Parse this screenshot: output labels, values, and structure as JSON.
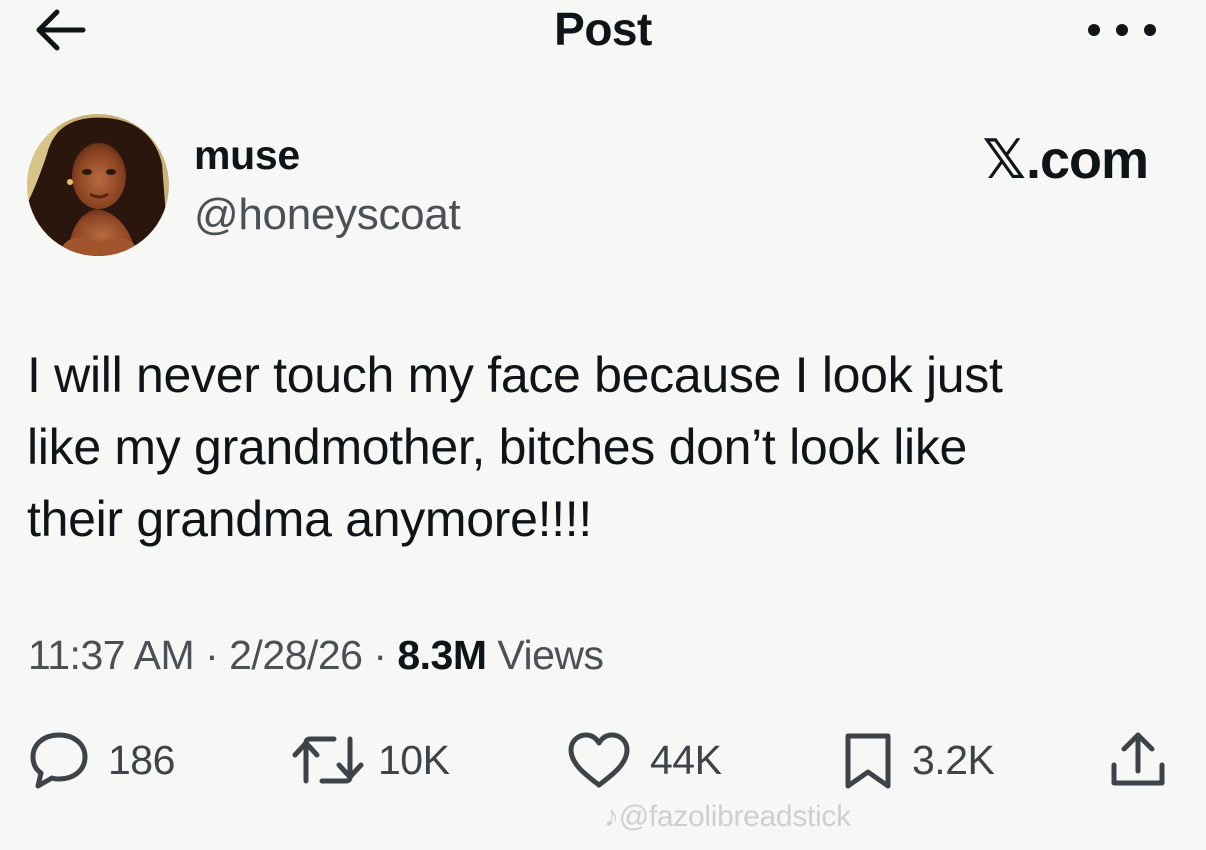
{
  "header": {
    "title": "Post",
    "back_icon": "arrow-left-icon",
    "more_icon": "more-horizontal-icon"
  },
  "author": {
    "display_name": "muse",
    "handle": "@honeyscoat",
    "avatar_icon": "profile-photo"
  },
  "brand": {
    "x_glyph": "𝕏",
    "domain": ".com"
  },
  "tweet": {
    "text": "I will never touch my face because I look just\nlike my grandmother, bitches don’t look like\ntheir grandma anymore!!!!"
  },
  "meta": {
    "time": "11:37 AM",
    "sep1": " · ",
    "date": "2/28/26",
    "sep2": " · ",
    "views_count": "8.3M",
    "views_label": " Views"
  },
  "actions": {
    "replies": "186",
    "reposts": "10K",
    "likes": "44K",
    "bookmarks": "3.2K"
  },
  "watermark": {
    "text": "♪@fazolibreadstick"
  },
  "colors": {
    "background": "#f7f8f6",
    "text": "#0f1419",
    "secondary_text": "#4a5056"
  }
}
